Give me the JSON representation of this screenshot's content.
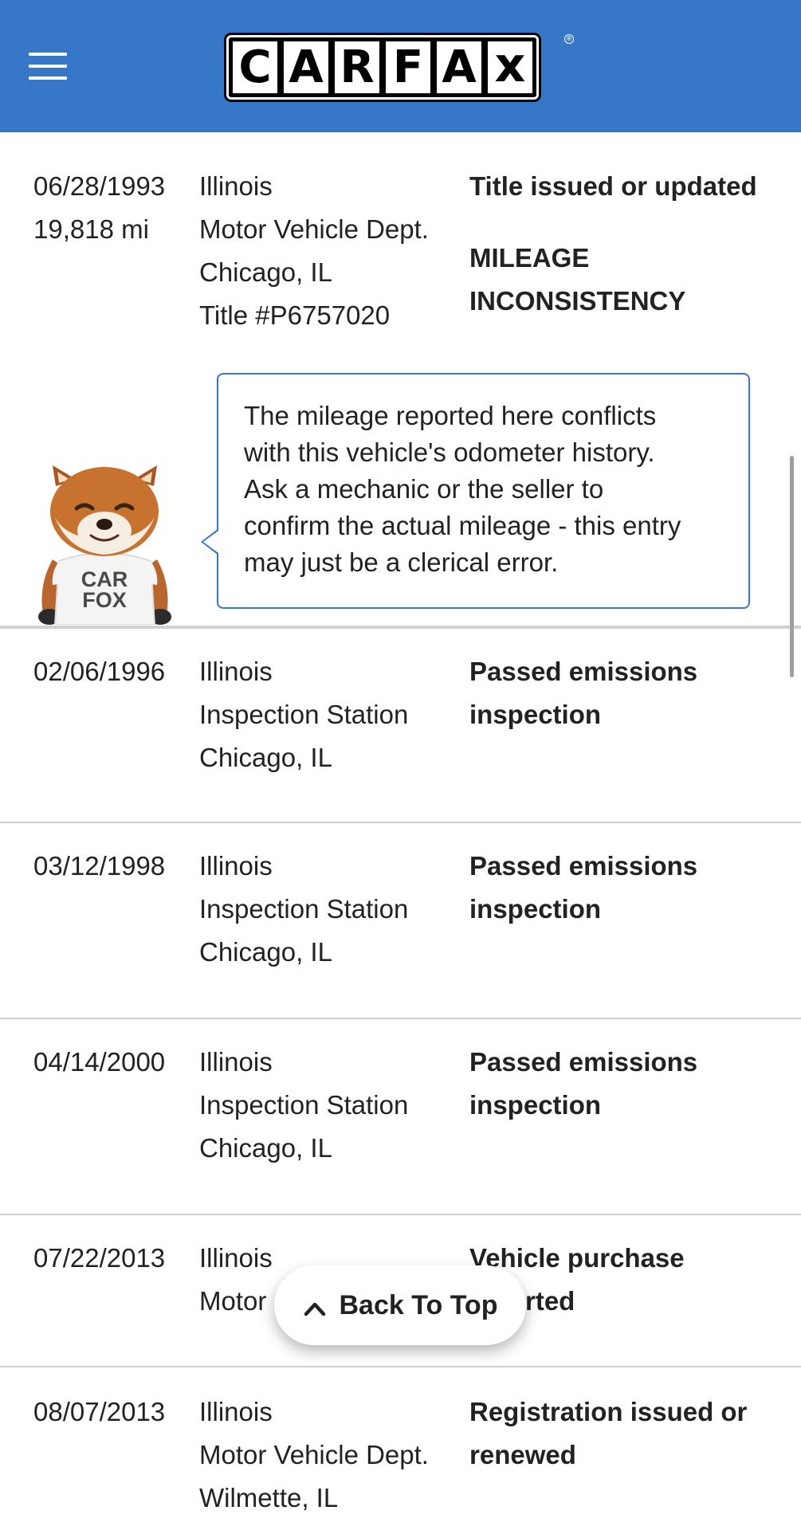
{
  "header": {
    "logo_letters": [
      "C",
      "A",
      "R",
      "F",
      "A",
      "x"
    ],
    "logo_reg": "®",
    "bg_color": "#3777c7"
  },
  "records": [
    {
      "date": "06/28/1993",
      "mileage": "19,818 mi",
      "source": [
        "Illinois",
        "Motor Vehicle Dept.",
        "Chicago, IL",
        "Title #P6757020"
      ],
      "events": [
        "Title issued or updated",
        "",
        "MILEAGE",
        "INCONSISTENCY"
      ]
    },
    {
      "date": "02/06/1996",
      "source": [
        "Illinois",
        "Inspection Station",
        "Chicago, IL"
      ],
      "events": [
        "Passed emissions",
        "inspection"
      ]
    },
    {
      "date": "03/12/1998",
      "source": [
        "Illinois",
        "Inspection Station",
        "Chicago, IL"
      ],
      "events": [
        "Passed emissions",
        "inspection"
      ]
    },
    {
      "date": "04/14/2000",
      "source": [
        "Illinois",
        "Inspection Station",
        "Chicago, IL"
      ],
      "events": [
        "Passed emissions",
        "inspection"
      ]
    },
    {
      "date": "07/22/2013",
      "source": [
        "Illinois",
        "Motor"
      ],
      "events": [
        "Vehicle purchase",
        "rted"
      ]
    },
    {
      "date": "08/07/2013",
      "source": [
        "Illinois",
        "Motor Vehicle Dept.",
        "Wilmette, IL"
      ],
      "events": [
        "Registration issued or",
        "renewed"
      ]
    }
  ],
  "callout": {
    "lines": [
      "The mileage reported here conflicts",
      "with this vehicle's odometer history.",
      "Ask a mechanic or the seller to",
      "confirm the actual mileage - this entry",
      "may just be a clerical error."
    ],
    "border_color": "#3777c7"
  },
  "mascot": {
    "shirt_line1": "CAR",
    "shirt_line2": "FOX"
  },
  "back_to_top": {
    "label": "Back To Top"
  }
}
